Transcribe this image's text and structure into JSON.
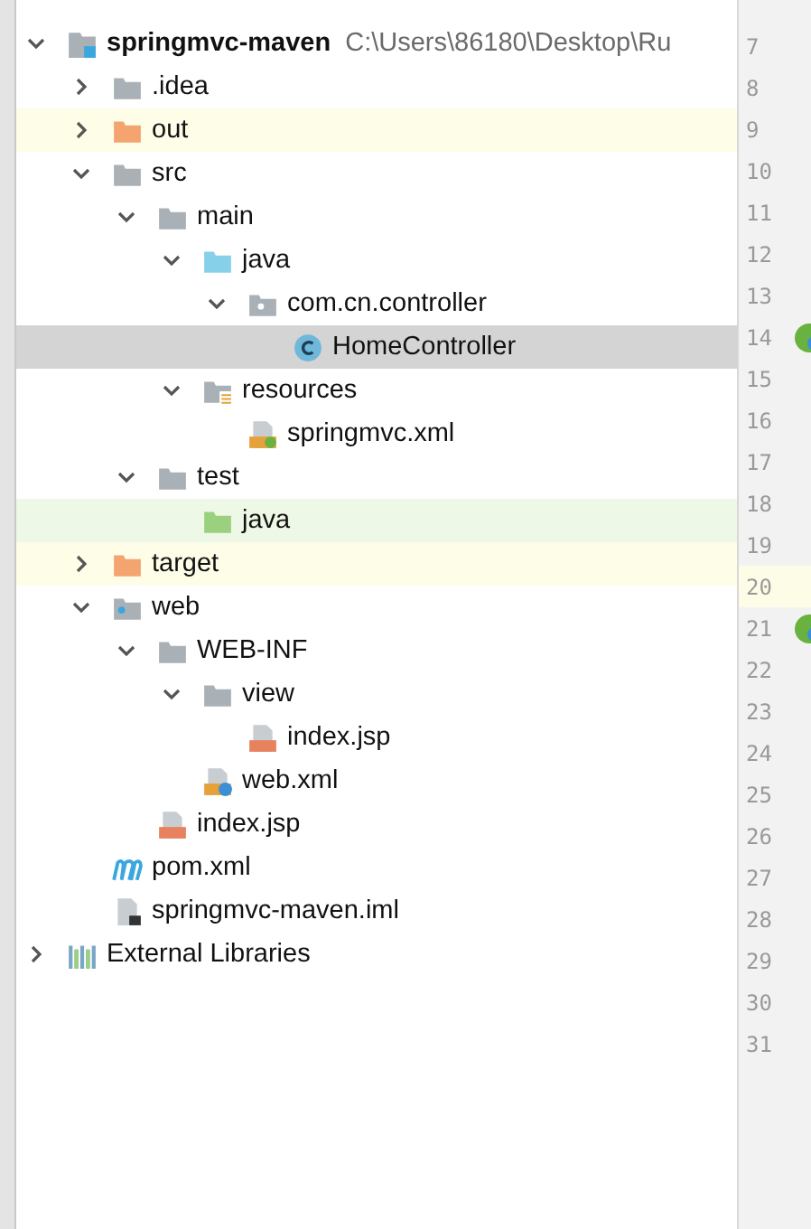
{
  "project_tree": [
    {
      "label": "springmvc-maven",
      "path": "C:\\Users\\86180\\Desktop\\Ru",
      "kind": "module",
      "expanded": true,
      "selected": false,
      "children": [
        {
          "label": ".idea",
          "kind": "folder",
          "expanded": false,
          "selected": false
        },
        {
          "label": "out",
          "kind": "excluded",
          "expanded": false,
          "selected": false
        },
        {
          "label": "src",
          "kind": "folder",
          "expanded": true,
          "selected": false,
          "children": [
            {
              "label": "main",
              "kind": "folder",
              "expanded": true,
              "selected": false,
              "children": [
                {
                  "label": "java",
                  "kind": "source",
                  "expanded": true,
                  "selected": false,
                  "children": [
                    {
                      "label": "com.cn.controller",
                      "kind": "package",
                      "expanded": true,
                      "selected": false,
                      "children": [
                        {
                          "label": "HomeController",
                          "kind": "class",
                          "selected": true
                        }
                      ]
                    }
                  ]
                },
                {
                  "label": "resources",
                  "kind": "resources",
                  "expanded": true,
                  "selected": false,
                  "children": [
                    {
                      "label": "springmvc.xml",
                      "kind": "spring-xml",
                      "selected": false
                    }
                  ]
                }
              ]
            },
            {
              "label": "test",
              "kind": "folder",
              "expanded": true,
              "selected": false,
              "children": [
                {
                  "label": "java",
                  "kind": "test-source",
                  "selected": false
                }
              ]
            }
          ]
        },
        {
          "label": "target",
          "kind": "excluded",
          "expanded": false,
          "selected": false
        },
        {
          "label": "web",
          "kind": "web",
          "expanded": true,
          "selected": false,
          "children": [
            {
              "label": "WEB-INF",
              "kind": "folder",
              "expanded": true,
              "selected": false,
              "children": [
                {
                  "label": "view",
                  "kind": "folder",
                  "expanded": true,
                  "selected": false,
                  "children": [
                    {
                      "label": "index.jsp",
                      "kind": "jsp",
                      "selected": false
                    }
                  ]
                },
                {
                  "label": "web.xml",
                  "kind": "web-xml",
                  "selected": false
                }
              ]
            },
            {
              "label": "index.jsp",
              "kind": "jsp",
              "selected": false
            }
          ]
        },
        {
          "label": "pom.xml",
          "kind": "maven",
          "selected": false
        },
        {
          "label": "springmvc-maven.iml",
          "kind": "iml",
          "selected": false
        }
      ]
    },
    {
      "label": "External Libraries",
      "kind": "libraries",
      "expanded": false,
      "selected": false
    }
  ],
  "gutter": {
    "lines": [
      {
        "number": "7",
        "current": false,
        "marker": false
      },
      {
        "number": "8",
        "current": false,
        "marker": false
      },
      {
        "number": "9",
        "current": false,
        "marker": false
      },
      {
        "number": "10",
        "current": false,
        "marker": false
      },
      {
        "number": "11",
        "current": false,
        "marker": false
      },
      {
        "number": "12",
        "current": false,
        "marker": false
      },
      {
        "number": "13",
        "current": false,
        "marker": false
      },
      {
        "number": "14",
        "current": false,
        "marker": true
      },
      {
        "number": "15",
        "current": false,
        "marker": false
      },
      {
        "number": "16",
        "current": false,
        "marker": false
      },
      {
        "number": "17",
        "current": false,
        "marker": false
      },
      {
        "number": "18",
        "current": false,
        "marker": false
      },
      {
        "number": "19",
        "current": false,
        "marker": false
      },
      {
        "number": "20",
        "current": true,
        "marker": false
      },
      {
        "number": "21",
        "current": false,
        "marker": true
      },
      {
        "number": "22",
        "current": false,
        "marker": false
      },
      {
        "number": "23",
        "current": false,
        "marker": false
      },
      {
        "number": "24",
        "current": false,
        "marker": false
      },
      {
        "number": "25",
        "current": false,
        "marker": false
      },
      {
        "number": "26",
        "current": false,
        "marker": false
      },
      {
        "number": "27",
        "current": false,
        "marker": false
      },
      {
        "number": "28",
        "current": false,
        "marker": false
      },
      {
        "number": "29",
        "current": false,
        "marker": false
      },
      {
        "number": "30",
        "current": false,
        "marker": false
      },
      {
        "number": "31",
        "current": false,
        "marker": false
      }
    ]
  }
}
